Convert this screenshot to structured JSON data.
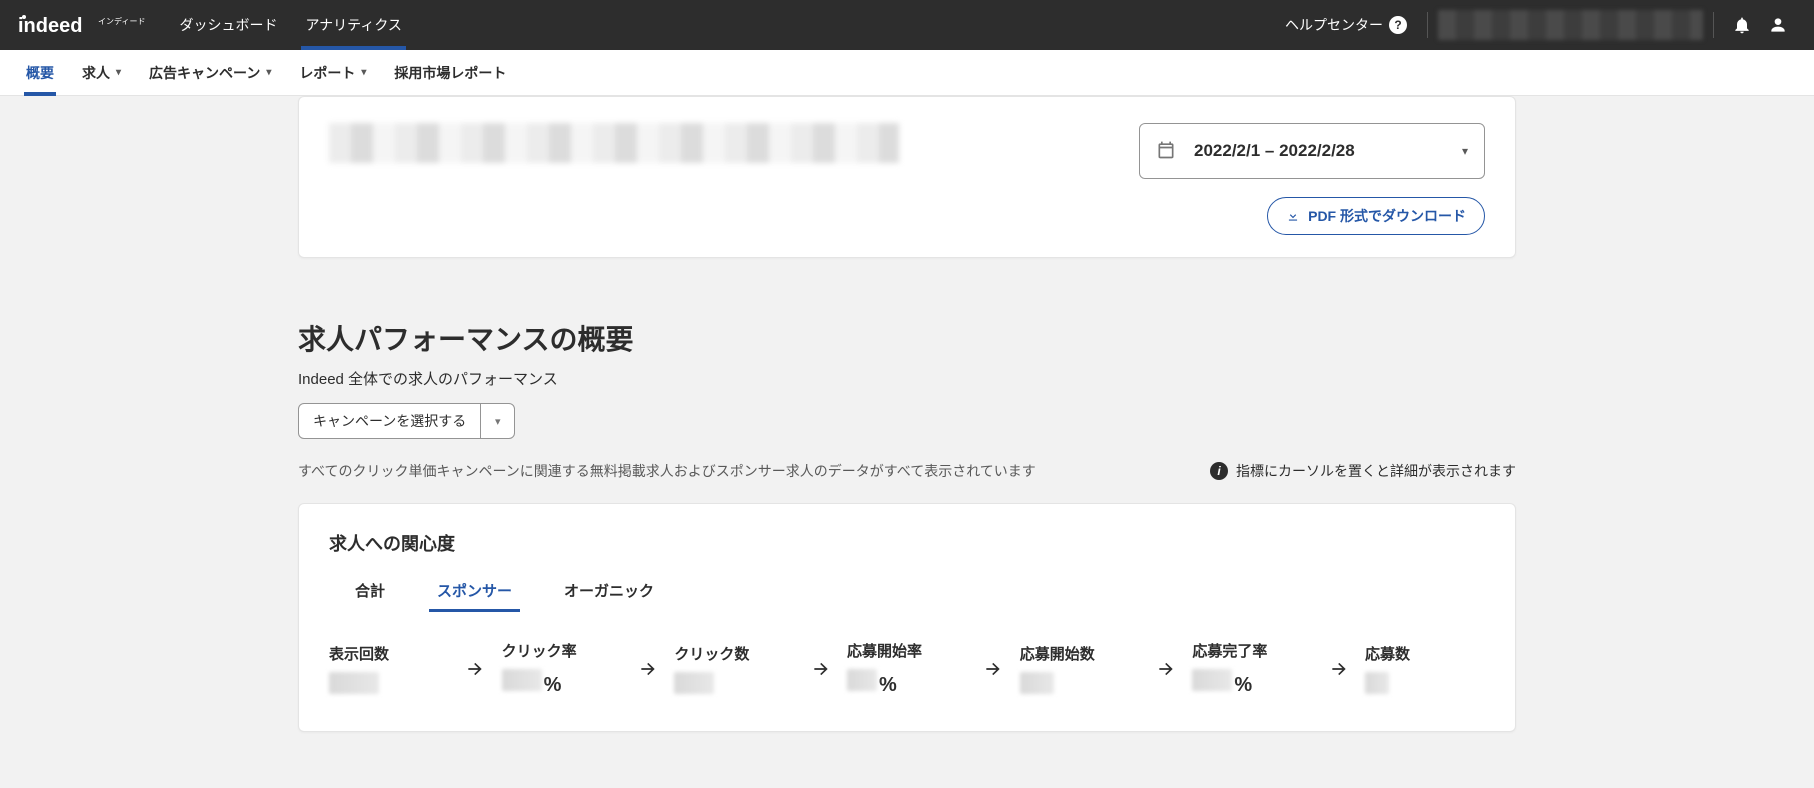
{
  "topnav": {
    "logo_ruby": "インディード",
    "items": [
      "ダッシュボード",
      "アナリティクス"
    ],
    "active_index": 1,
    "help_label": "ヘルプセンター"
  },
  "subnav": {
    "items": [
      {
        "label": "概要",
        "has_caret": false
      },
      {
        "label": "求人",
        "has_caret": true
      },
      {
        "label": "広告キャンペーン",
        "has_caret": true
      },
      {
        "label": "レポート",
        "has_caret": true
      },
      {
        "label": "採用市場レポート",
        "has_caret": false
      }
    ],
    "active_index": 0
  },
  "header_card": {
    "date_range": "2022/2/1 – 2022/2/28",
    "pdf_button": "PDF 形式でダウンロード"
  },
  "perf_section": {
    "title": "求人パフォーマンスの概要",
    "subtitle": "Indeed 全体での求人のパフォーマンス",
    "campaign_select_placeholder": "キャンペーンを選択する",
    "description": "すべてのクリック単価キャンペーンに関連する無料掲載求人およびスポンサー求人のデータがすべて表示されています",
    "hint": "指標にカーソルを置くと詳細が表示されます"
  },
  "interest_card": {
    "title": "求人への関心度",
    "tabs": [
      "合計",
      "スポンサー",
      "オーガニック"
    ],
    "active_tab_index": 1,
    "metrics": [
      {
        "label": "表示回数"
      },
      {
        "label": "クリック率",
        "unit": "%"
      },
      {
        "label": "クリック数"
      },
      {
        "label": "応募開始率",
        "unit": "%"
      },
      {
        "label": "応募開始数"
      },
      {
        "label": "応募完了率",
        "unit": "%"
      },
      {
        "label": "応募数"
      }
    ]
  }
}
